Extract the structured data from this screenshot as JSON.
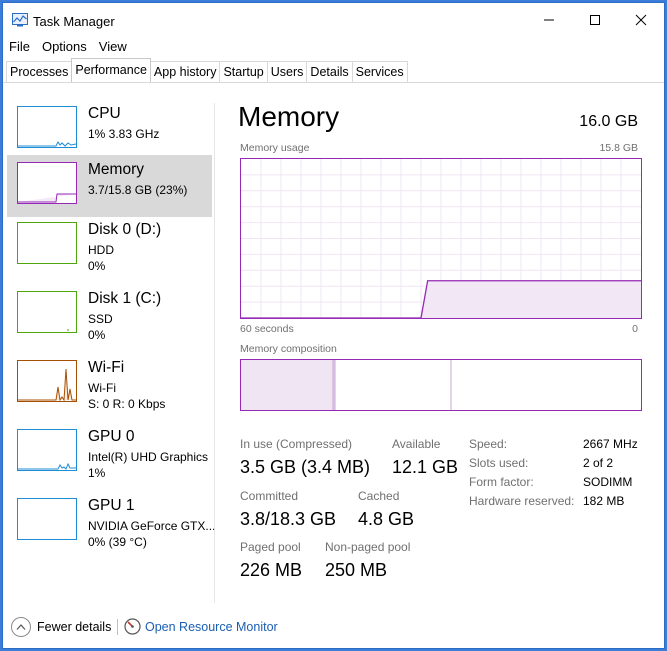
{
  "window": {
    "title": "Task Manager"
  },
  "menu": [
    "File",
    "Options",
    "View"
  ],
  "tabs": [
    {
      "label": "Processes",
      "active": false
    },
    {
      "label": "Performance",
      "active": true
    },
    {
      "label": "App history",
      "active": false
    },
    {
      "label": "Startup",
      "active": false
    },
    {
      "label": "Users",
      "active": false
    },
    {
      "label": "Details",
      "active": false
    },
    {
      "label": "Services",
      "active": false
    }
  ],
  "sidebar": {
    "items": [
      {
        "name": "CPU",
        "sub1": "1% 3.83 GHz",
        "sub2": "",
        "color": "#1f8dd6",
        "selected": false
      },
      {
        "name": "Memory",
        "sub1": "3.7/15.8 GB (23%)",
        "sub2": "",
        "color": "#9528b4",
        "selected": true
      },
      {
        "name": "Disk 0 (D:)",
        "sub1": "HDD",
        "sub2": "0%",
        "color": "#4da60c",
        "selected": false
      },
      {
        "name": "Disk 1 (C:)",
        "sub1": "SSD",
        "sub2": "0%",
        "color": "#4da60c",
        "selected": false
      },
      {
        "name": "Wi-Fi",
        "sub1": "Wi-Fi",
        "sub2": "S: 0 R: 0 Kbps",
        "color": "#a74f01",
        "selected": false
      },
      {
        "name": "GPU 0",
        "sub1": "Intel(R) UHD Graphics",
        "sub2": "1%",
        "color": "#1f8dd6",
        "selected": false
      },
      {
        "name": "GPU 1",
        "sub1": "NVIDIA GeForce GTX...",
        "sub2": "0% (39 °C)",
        "color": "#1f8dd6",
        "selected": false
      }
    ]
  },
  "main": {
    "title": "Memory",
    "total": "16.0 GB",
    "usage_label": "Memory usage",
    "usage_max": "15.8 GB",
    "x_left": "60 seconds",
    "x_right": "0",
    "composition_label": "Memory composition",
    "stats": {
      "in_use_label": "In use (Compressed)",
      "in_use_value": "3.5 GB (3.4 MB)",
      "available_label": "Available",
      "available_value": "12.1 GB",
      "committed_label": "Committed",
      "committed_value": "3.8/18.3 GB",
      "cached_label": "Cached",
      "cached_value": "4.8 GB",
      "paged_label": "Paged pool",
      "paged_value": "226 MB",
      "nonpaged_label": "Non-paged pool",
      "nonpaged_value": "250 MB"
    },
    "details": [
      {
        "label": "Speed:",
        "value": "2667 MHz"
      },
      {
        "label": "Slots used:",
        "value": "2 of 2"
      },
      {
        "label": "Form factor:",
        "value": "SODIMM"
      },
      {
        "label": "Hardware reserved:",
        "value": "182 MB"
      }
    ]
  },
  "chart_data": [
    {
      "type": "area",
      "title": "Memory usage",
      "x_range_label": [
        "60 seconds",
        "0"
      ],
      "ylim": [
        0,
        15.8
      ],
      "y_unit": "GB",
      "x": [
        60,
        33,
        32,
        0
      ],
      "values": [
        0,
        0,
        3.7,
        3.7
      ],
      "color": "#9528b4",
      "grid": true
    }
  ],
  "composition": {
    "in_use_fraction": 0.23,
    "modified_fraction": 0.005,
    "standby_fraction": 0.29
  },
  "footer": {
    "fewer_details": "Fewer details",
    "open_resource_monitor": "Open Resource Monitor"
  },
  "colors": {
    "memory": "#9528b4",
    "cpu": "#1f8dd6",
    "disk": "#4da60c",
    "wifi": "#a74f01",
    "link": "#1a5fb4",
    "selected_bg": "#d9d9d9"
  }
}
